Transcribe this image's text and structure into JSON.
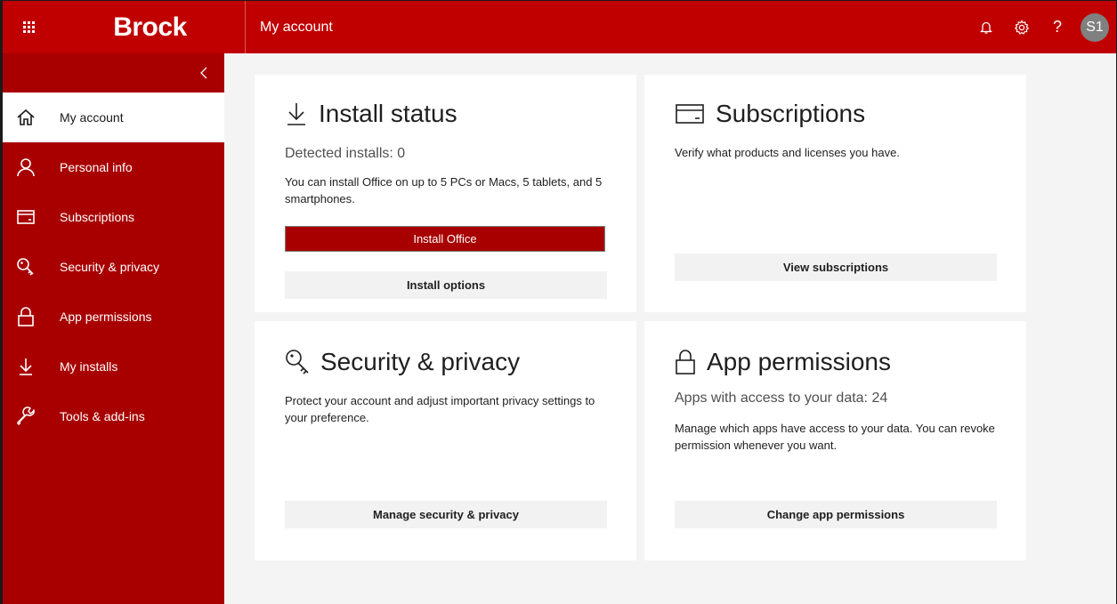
{
  "header": {
    "brand": "Brock",
    "page_title": "My account",
    "avatar_initials": "S1",
    "icons": [
      "waffle-icon",
      "bell-icon",
      "gear-icon",
      "help-icon"
    ]
  },
  "sidebar": {
    "items": [
      {
        "label": "My account",
        "icon": "home-icon",
        "active": true
      },
      {
        "label": "Personal info",
        "icon": "person-icon"
      },
      {
        "label": "Subscriptions",
        "icon": "card-icon"
      },
      {
        "label": "Security & privacy",
        "icon": "key-icon"
      },
      {
        "label": "App permissions",
        "icon": "lock-icon"
      },
      {
        "label": "My installs",
        "icon": "download-icon"
      },
      {
        "label": "Tools & add-ins",
        "icon": "wrench-icon"
      }
    ]
  },
  "cards": {
    "install": {
      "title": "Install status",
      "subheading": "Detected installs: 0",
      "description": "You can install Office on up to 5 PCs or Macs, 5 tablets, and 5 smartphones.",
      "primary_button": "Install Office",
      "secondary_button": "Install options"
    },
    "subscriptions": {
      "title": "Subscriptions",
      "description": "Verify what products and licenses you have.",
      "button": "View subscriptions"
    },
    "security": {
      "title": "Security & privacy",
      "description": "Protect your account and adjust important privacy settings to your preference.",
      "button": "Manage security & privacy"
    },
    "permissions": {
      "title": "App permissions",
      "subheading": "Apps with access to your data: 24",
      "description": "Manage which apps have access to your data. You can revoke permission whenever you want.",
      "button": "Change app permissions"
    }
  },
  "colors": {
    "header_red": "#c00000",
    "sidebar_red": "#a80000",
    "button_gray": "#f2f2f2"
  }
}
